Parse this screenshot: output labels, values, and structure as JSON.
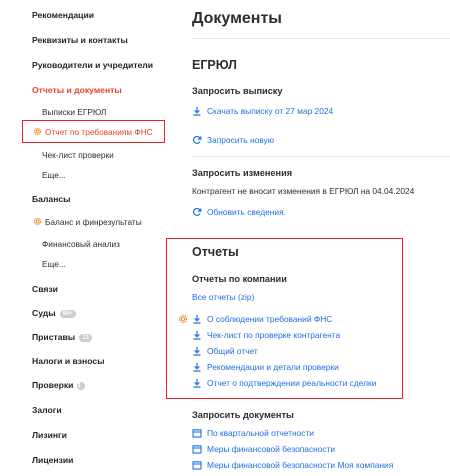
{
  "sidebar": {
    "items": [
      {
        "label": "Рекомендации"
      },
      {
        "label": "Реквизиты и контакты"
      },
      {
        "label": "Руководители и учредители"
      },
      {
        "label": "Отчеты и документы"
      },
      {
        "label": "Выписки ЕГРЮЛ"
      },
      {
        "label": "Отчет по требованиям ФНС"
      },
      {
        "label": "Чек-лист проверки"
      },
      {
        "label": "Еще..."
      },
      {
        "label": "Балансы"
      },
      {
        "label": "Баланс и финрезультаты"
      },
      {
        "label": "Финансовый анализ"
      },
      {
        "label": "Еще..."
      },
      {
        "label": "Связи"
      },
      {
        "label": "Суды",
        "badge": "99+"
      },
      {
        "label": "Приставы",
        "badge": "13"
      },
      {
        "label": "Налоги и взносы"
      },
      {
        "label": "Проверки",
        "badge": "1"
      },
      {
        "label": "Залоги"
      },
      {
        "label": "Лизинги"
      },
      {
        "label": "Лицензии"
      }
    ]
  },
  "main": {
    "title": "Документы",
    "egrul": {
      "heading": "ЕГРЮЛ",
      "request_extract": "Запросить выписку",
      "download_link": "Скачать выписку от 27 мар 2024",
      "request_new": "Запросить новую",
      "request_changes": "Запросить изменения",
      "changes_note": "Контрагент не вносит изменения в ЕГРЮЛ на 04.04.2024",
      "refresh_link": "Обновить сведения."
    },
    "reports": {
      "heading": "Отчеты",
      "subheading": "Отчеты по компании",
      "all_zip": "Все отчеты (zip)",
      "links": [
        "О соблюдении требований ФНС",
        "Чек-лист по проверке контрагента",
        "Общий отчет",
        "Рекомендации и детали проверки",
        "Отчет о подтверждении реальности сделки"
      ]
    },
    "request_docs": {
      "heading": "Запросить документы",
      "links": [
        "По квартальной отчетности",
        "Меры финансовой безопасности",
        "Меры финансовой безопасности Моя компания"
      ]
    }
  },
  "colors": {
    "accent_red": "#e5432f",
    "link_blue": "#1f6fe5",
    "highlight_border": "#e0262b",
    "gear_orange": "#f08a24"
  }
}
